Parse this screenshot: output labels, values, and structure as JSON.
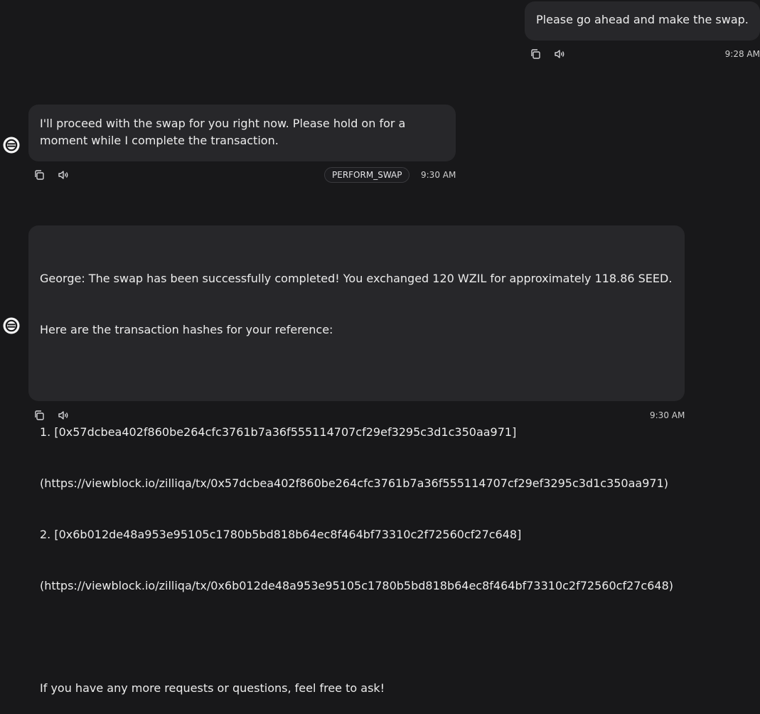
{
  "messages": [
    {
      "role": "user",
      "text": "Please go ahead and make the swap.",
      "time": "9:28 AM"
    },
    {
      "role": "agent",
      "lines": [
        "I'll proceed with the swap for you right now. Please hold on for a",
        "moment while I complete the transaction."
      ],
      "action": "PERFORM_SWAP",
      "time": "9:30 AM"
    },
    {
      "role": "agent",
      "lines": [
        "George: The swap has been successfully completed! You exchanged 120 WZIL for approximately 118.86 SEED.",
        "Here are the transaction hashes for your reference:",
        "",
        "1. [0x57dcbea402f860be264cfc3761b7a36f555114707cf29ef3295c3d1c350aa971]",
        "(https://viewblock.io/zilliqa/tx/0x57dcbea402f860be264cfc3761b7a36f555114707cf29ef3295c3d1c350aa971)",
        "2. [0x6b012de48a953e95105c1780b5bd818b64ec8f464bf73310c2f72560cf27c648]",
        "(https://viewblock.io/zilliqa/tx/0x6b012de48a953e95105c1780b5bd818b64ec8f464bf73310c2f72560cf27c648)",
        "",
        "If you have any more requests or questions, feel free to ask!"
      ],
      "time": "9:30 AM"
    }
  ],
  "icons": {
    "copy": "copy-icon",
    "speaker": "speaker-icon",
    "avatar": "agent-avatar-icon"
  },
  "colors": {
    "background": "#18181a",
    "bubble": "#27272a",
    "text": "#ececec"
  }
}
